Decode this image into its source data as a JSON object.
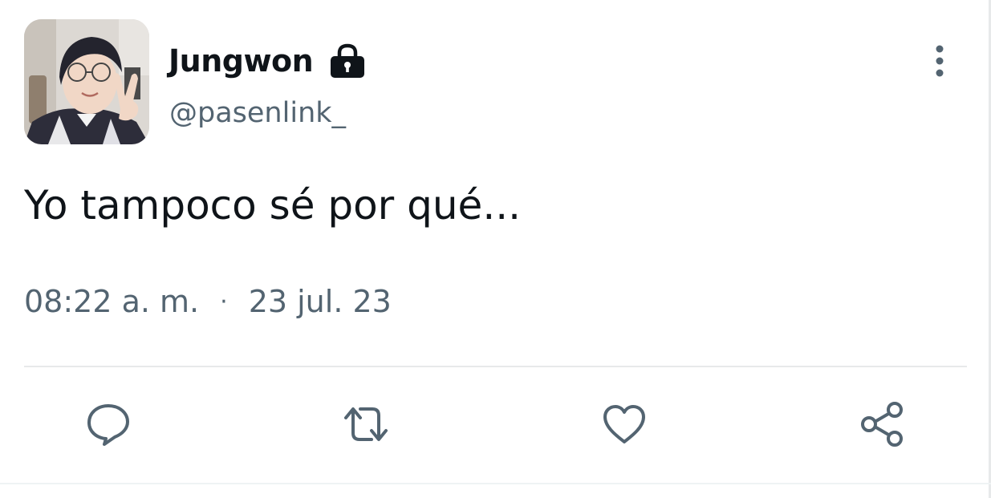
{
  "tweet": {
    "author": {
      "display_name": "Jungwon",
      "handle": "@pasenlink_",
      "protected_icon": "lock-icon"
    },
    "text": "Yo tampoco sé por qué...",
    "time": "08:22 a. m.",
    "separator": "·",
    "date": "23 jul. 23"
  },
  "actions": {
    "reply_icon": "reply-icon",
    "retweet_icon": "retweet-icon",
    "like_icon": "heart-icon",
    "share_icon": "share-icon",
    "more_icon": "more-vertical-icon"
  },
  "colors": {
    "text_primary": "#0f1419",
    "text_secondary": "#536471",
    "divider": "#e7e9ea"
  }
}
